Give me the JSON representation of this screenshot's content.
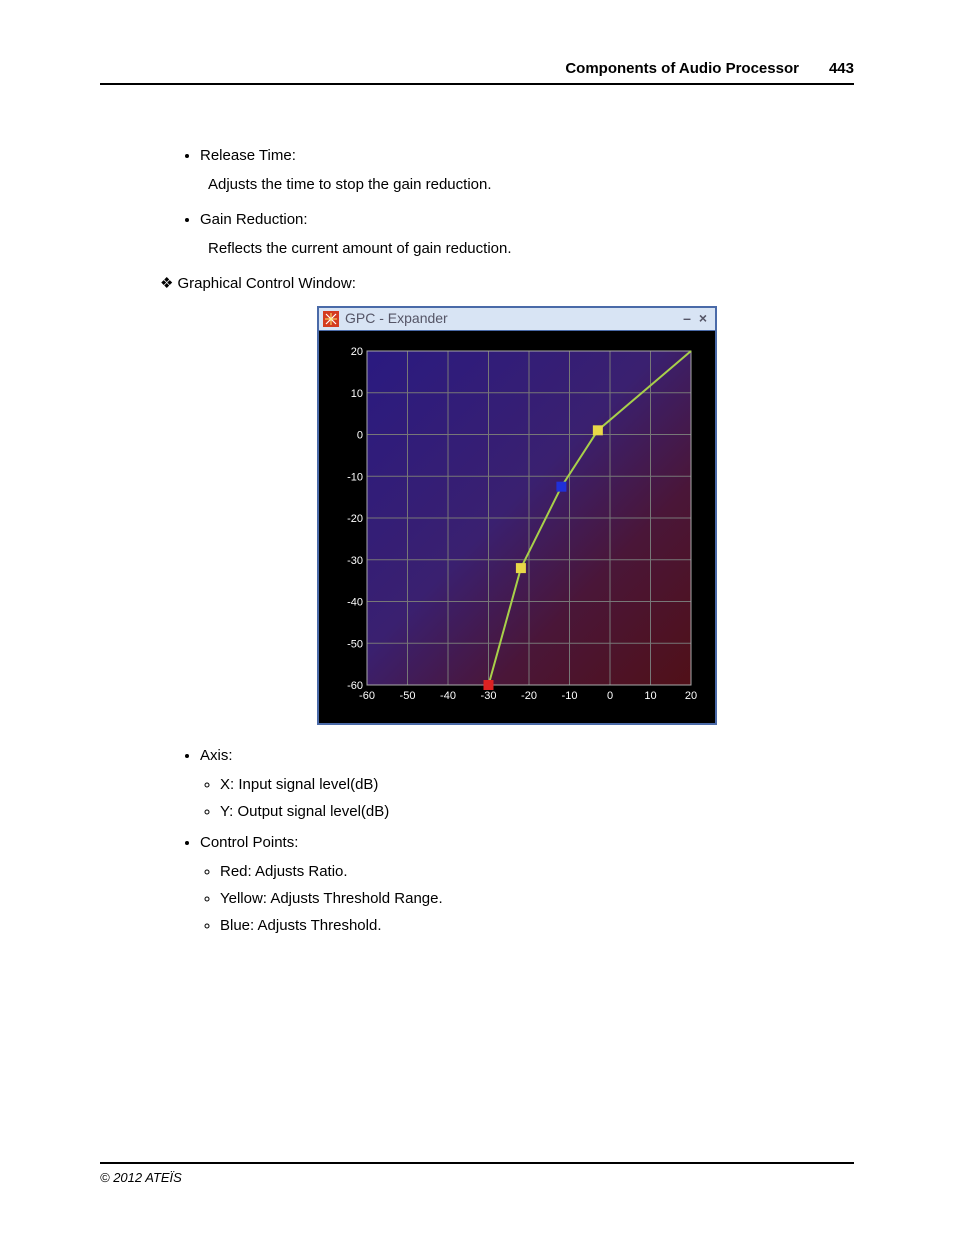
{
  "header": {
    "title": "Components of Audio Processor",
    "page_number": "443"
  },
  "body": {
    "release_time_label": "Release Time:",
    "release_time_desc": "Adjusts the time to stop the gain reduction.",
    "gain_reduction_label": "Gain Reduction:",
    "gain_reduction_desc": "Reflects the current amount of gain reduction.",
    "gcw_label": "Graphical Control Window:",
    "axis_label": "Axis:",
    "axis_x": "X: Input signal level(dB)",
    "axis_y": "Y: Output signal level(dB)",
    "control_points_label": "Control Points:",
    "cp_red": "Red: Adjusts Ratio.",
    "cp_yellow": "Yellow: Adjusts Threshold Range.",
    "cp_blue": "Blue: Adjusts Threshold."
  },
  "gpc": {
    "title": "GPC - Expander",
    "minimize": "–",
    "close": "×"
  },
  "chart_data": {
    "type": "line",
    "x_ticks": [
      -60,
      -50,
      -40,
      -30,
      -20,
      -10,
      0,
      10,
      20
    ],
    "y_ticks": [
      -60,
      -50,
      -40,
      -30,
      -20,
      -10,
      0,
      10,
      20
    ],
    "xlim": [
      -60,
      20
    ],
    "ylim": [
      -60,
      20
    ],
    "curve": [
      {
        "x": -30,
        "y": -60
      },
      {
        "x": -22,
        "y": -32
      },
      {
        "x": -12,
        "y": -12.5
      },
      {
        "x": -3,
        "y": 1
      },
      {
        "x": 20,
        "y": 20
      }
    ],
    "control_points": {
      "red": {
        "x": -30,
        "y": -60
      },
      "yellow_low": {
        "x": -22,
        "y": -32
      },
      "blue": {
        "x": -12,
        "y": -12.5
      },
      "yellow_high": {
        "x": -3,
        "y": 1
      }
    },
    "xlabel": "",
    "ylabel": ""
  },
  "footer": {
    "copyright": "© 2012 ATEÏS"
  }
}
